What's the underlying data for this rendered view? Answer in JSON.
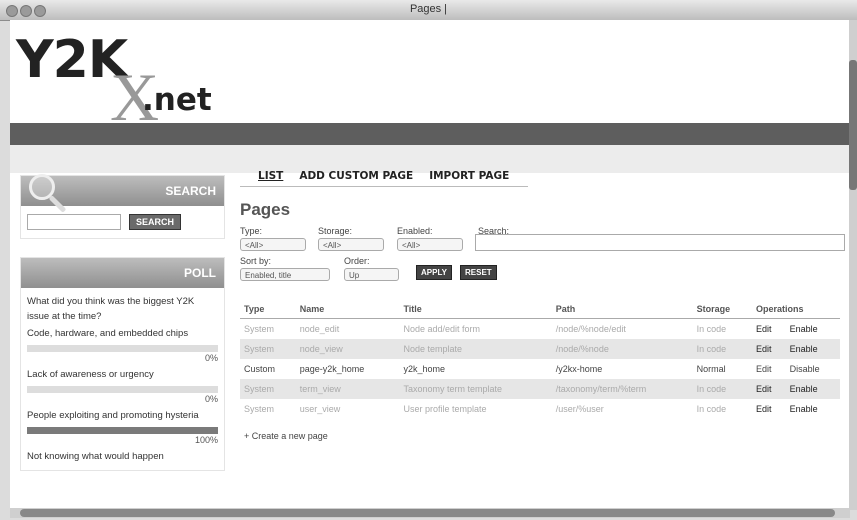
{
  "window": {
    "title": "Pages |"
  },
  "logo": {
    "y2k": "Y2K",
    "x": "X",
    "net": ".net"
  },
  "sidebar": {
    "search": {
      "heading": "SEARCH",
      "button": "SEARCH"
    },
    "poll": {
      "heading": "POLL",
      "question": "What did you think was the biggest Y2K issue at the time?",
      "choices": [
        {
          "label": "Code, hardware, and embedded chips",
          "pct": "0%",
          "value": 0
        },
        {
          "label": "Lack of awareness or urgency",
          "pct": "0%",
          "value": 0
        },
        {
          "label": "People exploiting and promoting hysteria",
          "pct": "100%",
          "value": 100
        },
        {
          "label": "Not knowing what would happen",
          "pct": "",
          "value": 0
        }
      ]
    }
  },
  "tabs": [
    "LIST",
    "ADD CUSTOM PAGE",
    "IMPORT PAGE"
  ],
  "page_title": "Pages",
  "filters": {
    "type_label": "Type:",
    "type_value": "<All>",
    "storage_label": "Storage:",
    "storage_value": "<All>",
    "enabled_label": "Enabled:",
    "enabled_value": "<All>",
    "search_label": "Search:",
    "sortby_label": "Sort by:",
    "sortby_value": "Enabled, title",
    "order_label": "Order:",
    "order_value": "Up",
    "apply": "APPLY",
    "reset": "RESET"
  },
  "table": {
    "headers": [
      "Type",
      "Name",
      "Title",
      "Path",
      "Storage",
      "Operations"
    ],
    "rows": [
      {
        "type": "System",
        "name": "node_edit",
        "title": "Node add/edit form",
        "path": "/node/%node/edit",
        "storage": "In code",
        "op1": "Edit",
        "op2": "Enable"
      },
      {
        "type": "System",
        "name": "node_view",
        "title": "Node template",
        "path": "/node/%node",
        "storage": "In code",
        "op1": "Edit",
        "op2": "Enable"
      },
      {
        "type": "Custom",
        "name": "page-y2k_home",
        "title": "y2k_home",
        "path": "/y2kx-home",
        "storage": "Normal",
        "op1": "Edit",
        "op2": "Disable"
      },
      {
        "type": "System",
        "name": "term_view",
        "title": "Taxonomy term template",
        "path": "/taxonomy/term/%term",
        "storage": "In code",
        "op1": "Edit",
        "op2": "Enable"
      },
      {
        "type": "System",
        "name": "user_view",
        "title": "User profile template",
        "path": "/user/%user",
        "storage": "In code",
        "op1": "Edit",
        "op2": "Enable"
      }
    ]
  },
  "create_link": "+ Create a new page"
}
